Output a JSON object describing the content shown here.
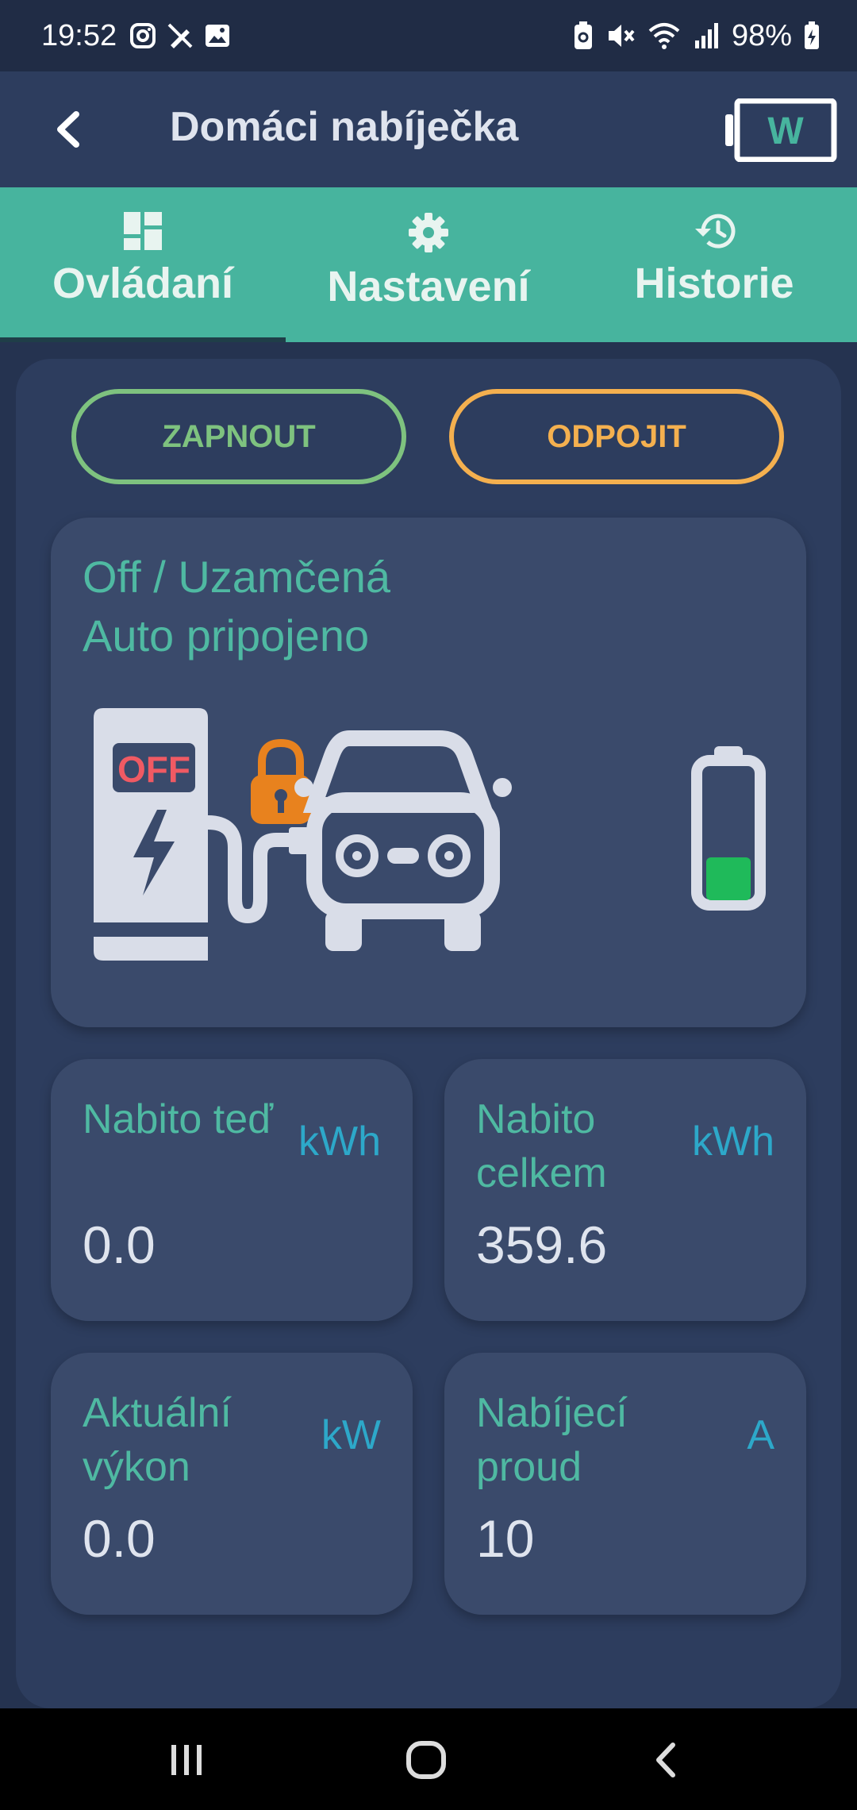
{
  "status_bar": {
    "time": "19:52",
    "battery": "98%",
    "icons": [
      "instagram-icon",
      "pen-off-icon",
      "image-icon",
      "battery-saver-icon",
      "mute-icon",
      "wifi-icon",
      "signal-icon",
      "battery-icon"
    ]
  },
  "app_bar": {
    "title": "Domáci nabíječka",
    "logo_letter": "W"
  },
  "tabs": [
    {
      "label": "Ovládaní",
      "icon": "dashboard-icon",
      "active": true
    },
    {
      "label": "Nastavení",
      "icon": "gear-icon",
      "active": false
    },
    {
      "label": "Historie",
      "icon": "history-icon",
      "active": false
    }
  ],
  "actions": {
    "on_label": "ZAPNOUT",
    "disconnect_label": "ODPOJIT"
  },
  "status": {
    "line1": "Off / Uzamčená",
    "line2": "Auto pripojeno",
    "charger_badge": "OFF"
  },
  "metrics": [
    {
      "label": "Nabito teď",
      "unit": "kWh",
      "value": "0.0"
    },
    {
      "label": "Nabito celkem",
      "unit": "kWh",
      "value": "359.6"
    },
    {
      "label": "Aktuální výkon",
      "unit": "kW",
      "value": "0.0"
    },
    {
      "label": "Nabíjecí proud",
      "unit": "A",
      "value": "10"
    }
  ],
  "colors": {
    "accent": "#47b49e",
    "on": "#7ec27f",
    "disconnect": "#f4b04f",
    "lock": "#e8821e",
    "battery_fill": "#1fba5a",
    "unit": "#2da8c9"
  }
}
